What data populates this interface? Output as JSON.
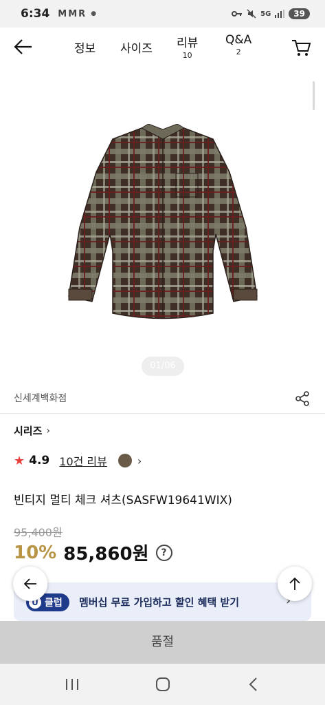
{
  "status_bar": {
    "time": "6:34",
    "left_icons": [
      "M",
      "M",
      "R"
    ],
    "network": "5G",
    "battery": "39"
  },
  "nav": {
    "tabs": [
      {
        "label": "정보",
        "count": ""
      },
      {
        "label": "사이즈",
        "count": ""
      },
      {
        "label": "리뷰",
        "count": "10"
      },
      {
        "label": "Q&A",
        "count": "2"
      }
    ]
  },
  "gallery": {
    "page_indicator": "01/06"
  },
  "brand": {
    "name": "신세계백화점"
  },
  "series": {
    "label": "시리즈",
    "chevron": "›"
  },
  "rating": {
    "value": "4.9",
    "review_link": "10건 리뷰"
  },
  "product": {
    "name": "빈티지 멀티 체크 셔츠(SASFW19641WIX)",
    "original_price": "95,400원",
    "discount": "10%",
    "sale_price": "85,860원",
    "help_symbol": "?"
  },
  "membership_banner": {
    "badge_letter": "U",
    "badge_label": "클럽",
    "text": "멤버십 무료 가입하고 할인 혜택 받기"
  },
  "bottom_bar": {
    "soldout_label": "품절"
  },
  "colors": {
    "discount": "#b89545",
    "star": "#e8413b",
    "banner_bg": "#eaeef9",
    "badge_bg": "#1e3a8a",
    "soldout_bg": "#cfcfcf"
  }
}
